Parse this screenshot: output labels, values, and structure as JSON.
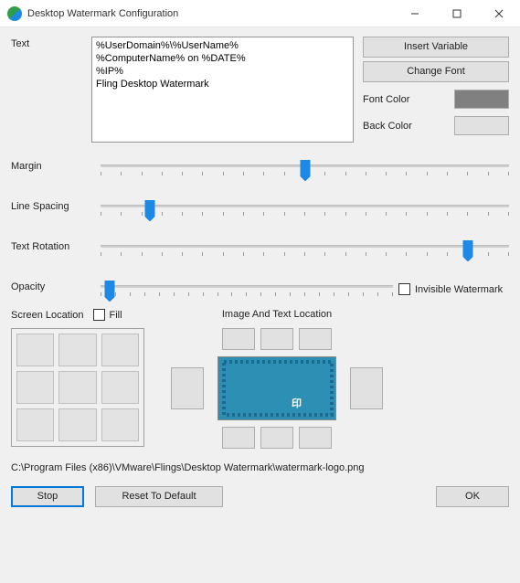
{
  "window": {
    "title": "Desktop Watermark Configuration"
  },
  "labels": {
    "text": "Text",
    "margin": "Margin",
    "line_spacing": "Line Spacing",
    "text_rotation": "Text Rotation",
    "opacity": "Opacity",
    "screen_location": "Screen Location",
    "fill": "Fill",
    "image_text_location": "Image And Text Location",
    "invisible": "Invisible Watermark",
    "font_color": "Font Color",
    "back_color": "Back Color"
  },
  "buttons": {
    "insert_variable": "Insert Variable",
    "change_font": "Change Font",
    "stop": "Stop",
    "reset": "Reset To Default",
    "ok": "OK"
  },
  "text_value": "%UserDomain%\\%UserName%\n%ComputerName% on %DATE%\n%IP%\nFling Desktop Watermark",
  "colors": {
    "font": "#808080",
    "back": "#e1e1e1"
  },
  "sliders": {
    "margin_pct": 50,
    "line_spacing_pct": 12,
    "text_rotation_pct": 90,
    "opacity_pct": 3
  },
  "checks": {
    "fill": false,
    "invisible": false
  },
  "path": "C:\\Program Files (x86)\\VMware\\Flings\\Desktop Watermark\\watermark-logo.png",
  "chart_data": null
}
